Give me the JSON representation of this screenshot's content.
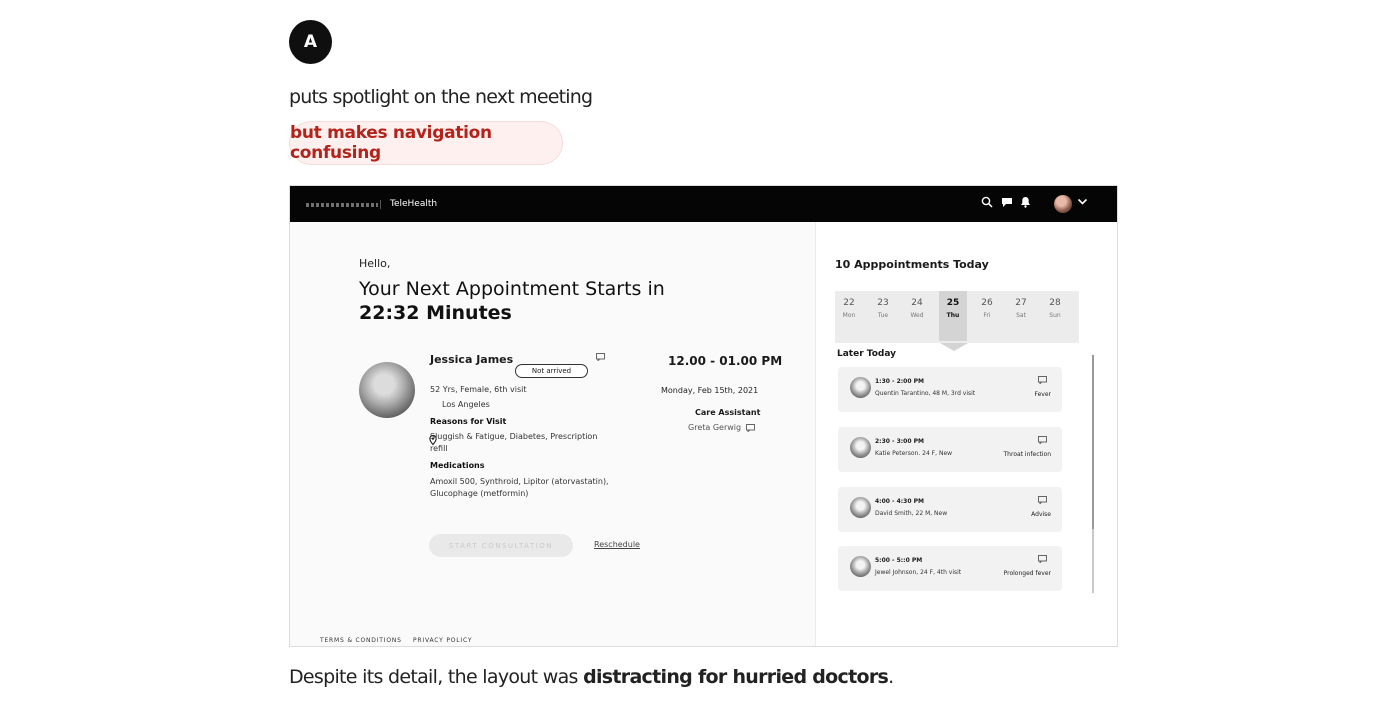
{
  "avatar_letter": "A",
  "lead_text": "puts spotlight on the next meeting",
  "highlight_text": "but makes navigation confusing",
  "caption": {
    "pre": "Despite its detail, the layout was",
    "emphasis": "distracting for hurried doctors",
    "post": "."
  },
  "app": {
    "product_name": "TeleHealth",
    "icons": [
      "search-icon",
      "chat-icon",
      "bell-icon",
      "user-avatar",
      "chevron-down-icon"
    ],
    "greeting": "Hello,",
    "next_line": "Your Next Appointment Starts in",
    "countdown": "22:32 Minutes",
    "patient": {
      "name": "Jessica James",
      "status": "Not arrived",
      "details": "52 Yrs, Female, 6th visit",
      "location": "Los Angeles",
      "reasons_label": "Reasons for Visit",
      "reasons_line1": "Sluggish & Fatigue, Diabetes, Prescription",
      "reasons_line2": "refill",
      "medications_label": "Medications",
      "medications_line1": "Amoxil 500, Synthroid, Lipitor (atorvastatin),",
      "medications_line2": "Glucophage (metformin)"
    },
    "time_range": "12.00 - 01.00 PM",
    "date": "Monday, Feb 15th, 2021",
    "care_label": "Care Assistant",
    "care_name": "Greta Gerwig",
    "start_button": "START CONSULTATION",
    "reschedule": "Reschedule",
    "footer": {
      "terms": "TERMS & CONDITIONS",
      "privacy": "PRIVACY POLICY"
    },
    "appointments_title": "10 Apppointments Today",
    "days": [
      {
        "num": "22",
        "name": "Mon"
      },
      {
        "num": "23",
        "name": "Tue"
      },
      {
        "num": "24",
        "name": "Wed"
      },
      {
        "num": "25",
        "name": "Thu",
        "selected": true
      },
      {
        "num": "26",
        "name": "Fri"
      },
      {
        "num": "27",
        "name": "Sat"
      },
      {
        "num": "28",
        "name": "Sun"
      }
    ],
    "later_today": "Later Today",
    "appointments": [
      {
        "time": "1:30 - 2:00 PM",
        "desc": "Quentin Tarantino, 48 M, 3rd visit",
        "reason": "Fever"
      },
      {
        "time": "2:30 - 3:00 PM",
        "desc": "Katie Peterson. 24 F, New",
        "reason": "Throat infection"
      },
      {
        "time": "4:00 - 4:30 PM",
        "desc": "David Smith, 22 M, New",
        "reason": "Advise"
      },
      {
        "time": "5:00 - 5::0 PM",
        "desc": "Jewel Johnson, 24 F, 4th visit",
        "reason": "Prolonged fever"
      }
    ]
  }
}
